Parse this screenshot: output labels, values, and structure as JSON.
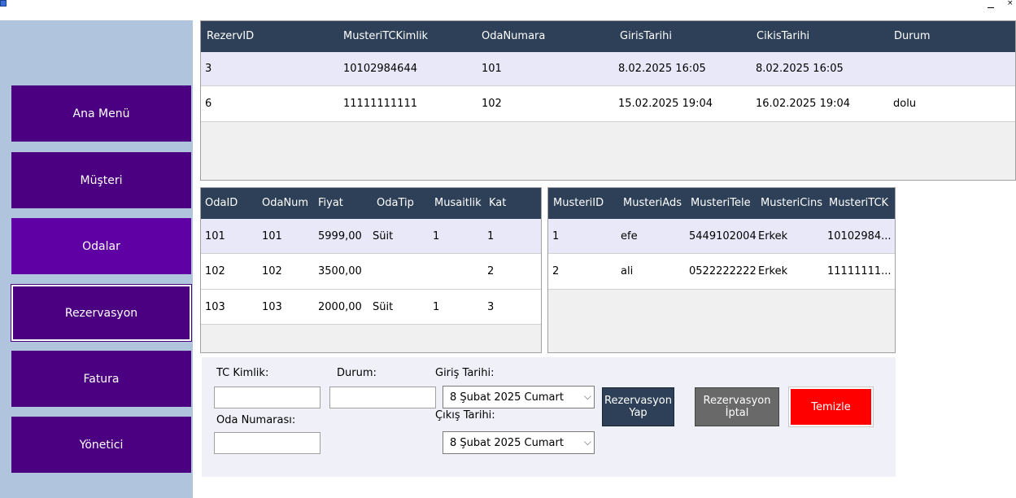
{
  "window": {
    "close_glyph": "×"
  },
  "sidebar": {
    "items": [
      {
        "label": "Ana Menü"
      },
      {
        "label": "Müşteri"
      },
      {
        "label": "Odalar"
      },
      {
        "label": "Rezervasyon"
      },
      {
        "label": "Fatura"
      },
      {
        "label": "Yönetici"
      }
    ]
  },
  "reservations": {
    "columns": [
      "RezervID",
      "MusteriTCKimlik",
      "OdaNumara",
      "GirisTarihi",
      "CikisTarihi",
      "Durum"
    ],
    "rows": [
      [
        "3",
        "10102984644",
        "101",
        "8.02.2025 16:05",
        "8.02.2025 16:05",
        ""
      ],
      [
        "6",
        "11111111111",
        "102",
        "15.02.2025 19:04",
        "16.02.2025 19:04",
        "dolu"
      ]
    ]
  },
  "rooms": {
    "columns": [
      "OdaID",
      "OdaNum",
      "Fiyat",
      "OdaTip",
      "Musaitlik",
      "Kat"
    ],
    "rows": [
      [
        "101",
        "101",
        "5999,00",
        "Süit",
        "1",
        "1"
      ],
      [
        "102",
        "102",
        "3500,00",
        "",
        "",
        "2"
      ],
      [
        "103",
        "103",
        "2000,00",
        "Süit",
        "1",
        "3"
      ]
    ]
  },
  "customers": {
    "columns": [
      "MusteriID",
      "MusteriAds",
      "MusteriTele",
      "MusteriCins",
      "MusteriTCK"
    ],
    "rows": [
      [
        "1",
        "efe",
        "5449102004",
        "Erkek",
        "10102984..."
      ],
      [
        "2",
        "ali",
        "0522222222",
        "Erkek",
        "11111111..."
      ]
    ]
  },
  "form": {
    "tc_label": "TC Kimlik:",
    "tc_value": "",
    "durum_label": "Durum:",
    "durum_value": "",
    "oda_label": "Oda Numarası:",
    "oda_value": "",
    "giris_label": "Giriş Tarihi:",
    "giris_value": "8  Şubat  2025 Cumart",
    "cikis_label": "Çıkış Tarihi:",
    "cikis_value": "8  Şubat  2025 Cumart",
    "dropdown_glyph": "⌵",
    "btn_reserve": "Rezervasyon\nYap",
    "btn_cancel": "Rezervasyon\nİptal",
    "btn_clear": "Temizle"
  },
  "colors": {
    "nav_bg": "#4b0082",
    "grid_header": "#2e4057",
    "reserve_btn": "#2e4057",
    "cancel_btn": "#696969",
    "clear_btn": "#ff0000"
  }
}
